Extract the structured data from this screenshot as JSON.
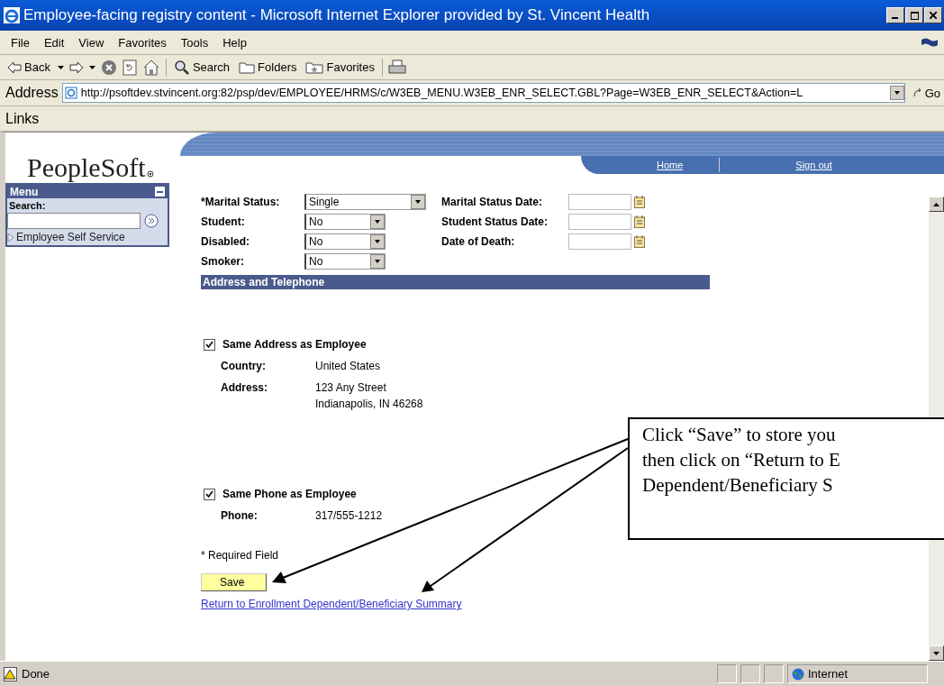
{
  "window": {
    "title": "Employee-facing registry content - Microsoft Internet Explorer provided by St. Vincent Health"
  },
  "menu_bar": [
    "File",
    "Edit",
    "View",
    "Favorites",
    "Tools",
    "Help"
  ],
  "toolbar": [
    {
      "kind": "back",
      "label": "Back"
    },
    {
      "kind": "forward"
    },
    {
      "kind": "stop"
    },
    {
      "kind": "refresh"
    },
    {
      "kind": "home"
    },
    {
      "kind": "search",
      "label": "Search"
    },
    {
      "kind": "folders",
      "label": "Folders"
    },
    {
      "kind": "favorites",
      "label": "Favorites"
    },
    {
      "kind": "print"
    }
  ],
  "address_bar": {
    "label": "Address",
    "url": "http://psoftdev.stvincent.org:82/psp/dev/EMPLOYEE/HRMS/c/W3EB_MENU.W3EB_ENR_SELECT.GBL?Page=W3EB_ENR_SELECT&Action=L",
    "go": "Go"
  },
  "links_bar": {
    "label": "Links"
  },
  "page": {
    "logo": "PeopleSoft",
    "nav": [
      "Home",
      "Sign out"
    ],
    "menu": {
      "title": "Menu",
      "search_label": "Search:",
      "items": [
        {
          "label": "Employee Self Service",
          "expanded": false
        }
      ]
    },
    "form": {
      "left": [
        {
          "label": "*Marital Status:",
          "value": "Single"
        },
        {
          "label": "Student:",
          "value": "No"
        },
        {
          "label": "Disabled:",
          "value": "No"
        },
        {
          "label": "Smoker:",
          "value": "No"
        }
      ],
      "right": [
        {
          "label": "Marital Status Date:"
        },
        {
          "label": "Student Status Date:"
        },
        {
          "label": "Date of Death:"
        }
      ],
      "section": "Address and Telephone",
      "address": {
        "checkbox": {
          "label": "Same Address as Employee",
          "checked": true
        },
        "fields": [
          {
            "label": "Country:",
            "lines": [
              "United States"
            ]
          },
          {
            "label": "Address:",
            "lines": [
              "123 Any Street",
              "Indianapolis, IN 46268"
            ]
          }
        ]
      },
      "phone": {
        "checkbox": {
          "label": "Same Phone as Employee",
          "checked": true
        },
        "fields": [
          {
            "label": "Phone:",
            "lines": [
              "317/555-1212"
            ]
          }
        ]
      },
      "required_note": "* Required Field",
      "save_button": "Save",
      "return_link": "Return to Enrollment Dependent/Beneficiary Summary"
    }
  },
  "callout": {
    "lines": [
      "Click “Save” to store you",
      "then click on “Return to E",
      "Dependent/Beneficiary S"
    ]
  },
  "status_bar": {
    "text": "Done",
    "zone": "Internet"
  }
}
